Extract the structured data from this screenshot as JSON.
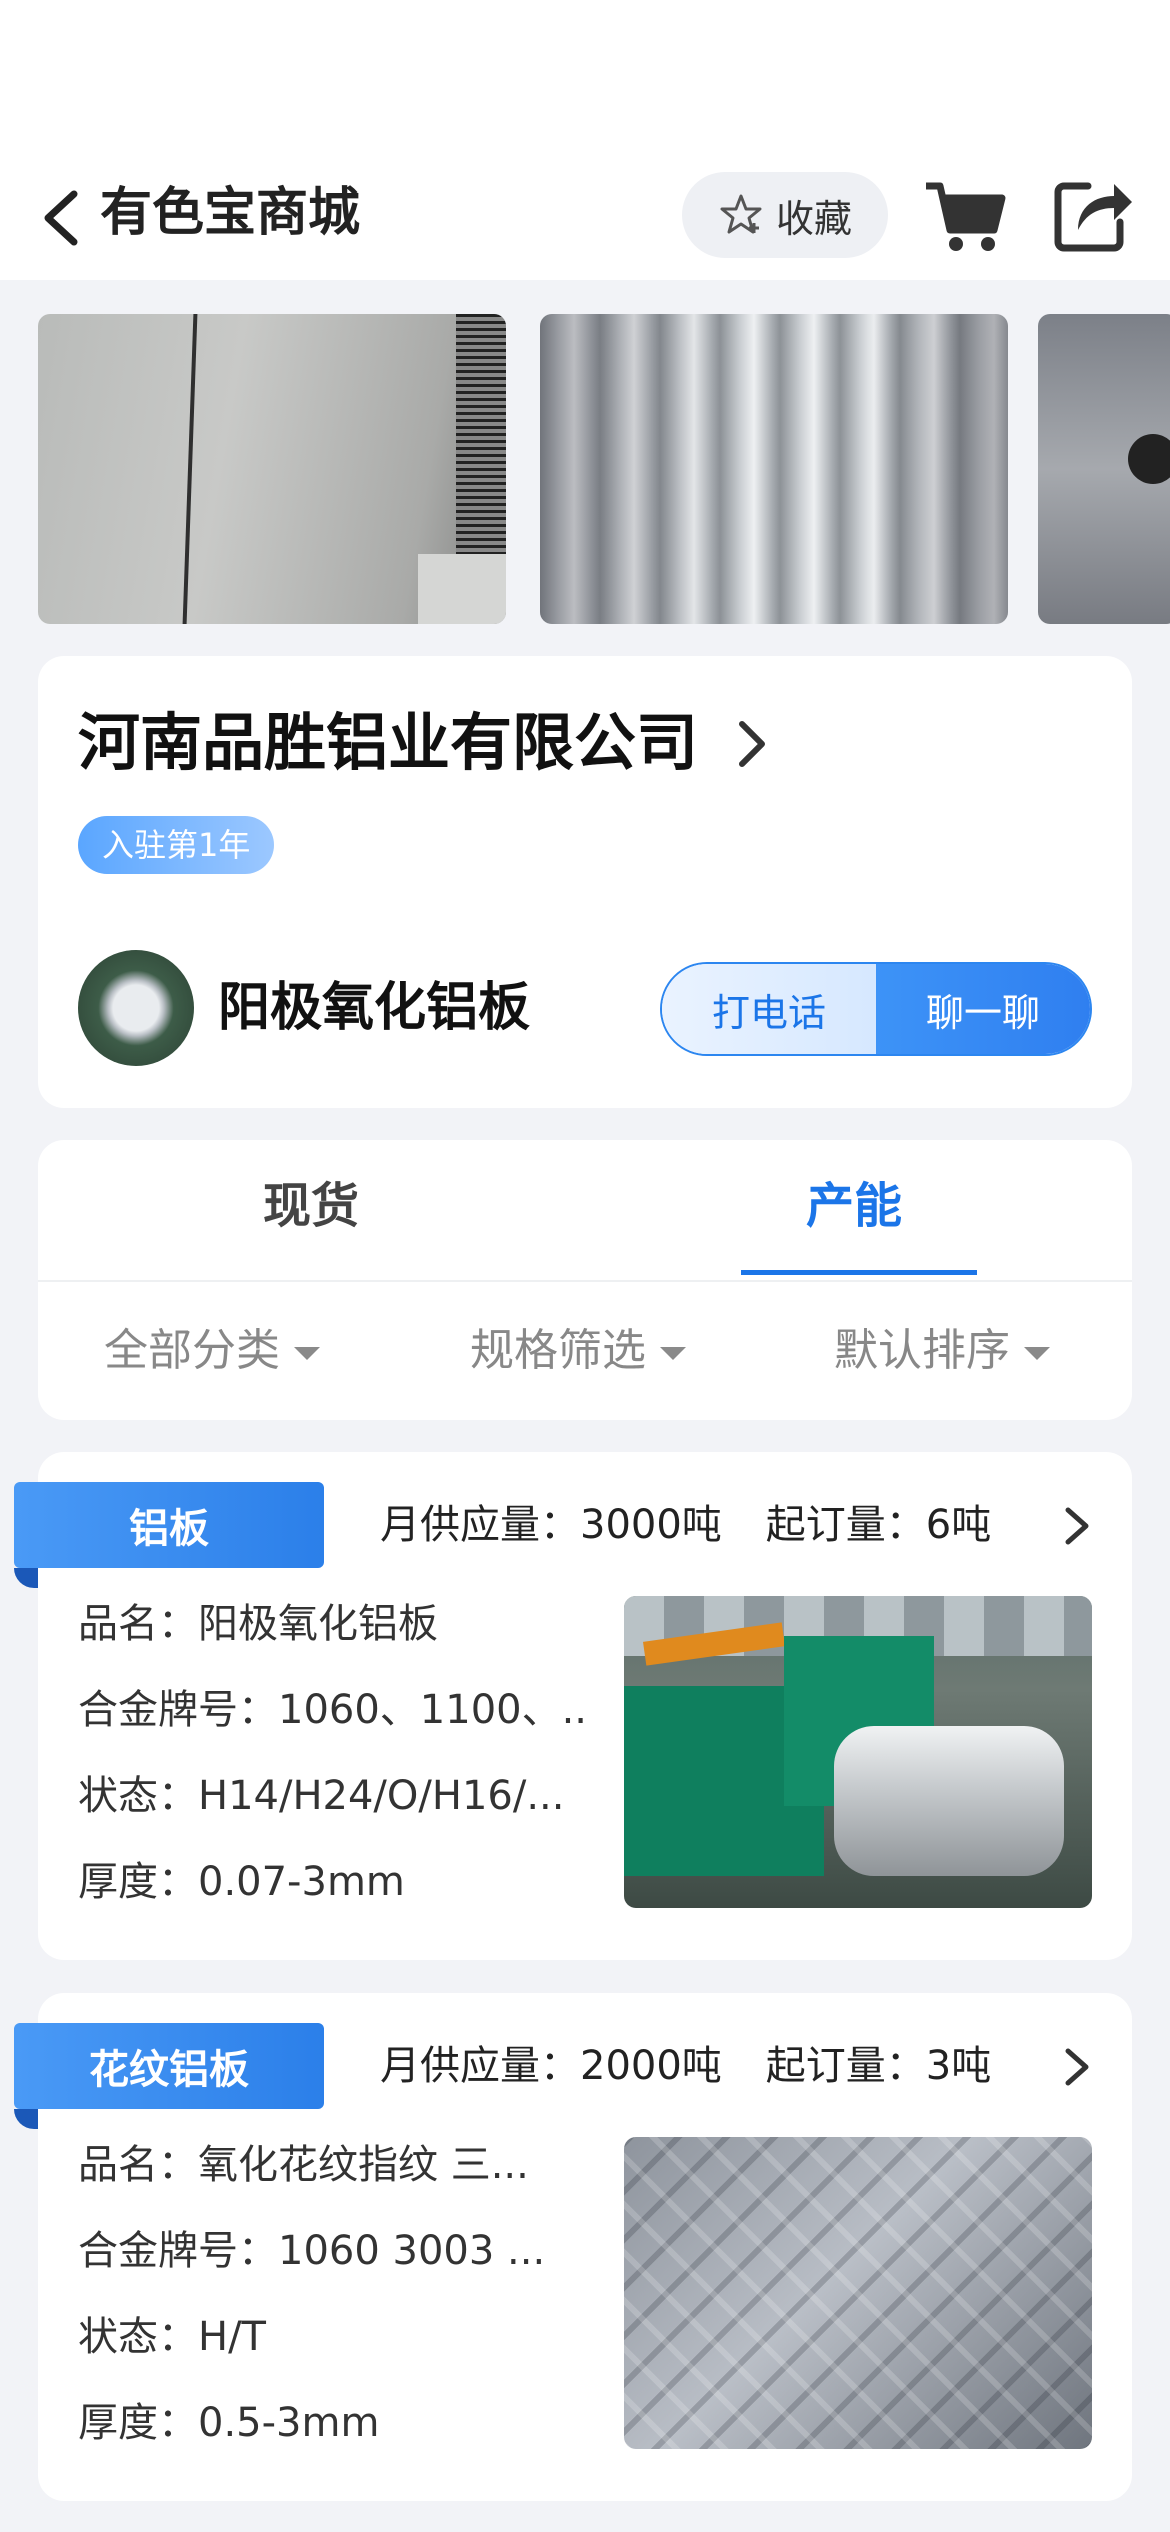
{
  "nav": {
    "title": "有色宝商城",
    "favorite_label": "收藏"
  },
  "company": {
    "name": "河南品胜铝业有限公司",
    "tenure_badge": "入驻第1年",
    "shop_name": "阳极氧化铝板",
    "call_label": "打电话",
    "chat_label": "聊一聊"
  },
  "tabs": [
    {
      "label": "现货",
      "active": false
    },
    {
      "label": "产能",
      "active": true
    }
  ],
  "filters": [
    {
      "label": "全部分类"
    },
    {
      "label": "规格筛选"
    },
    {
      "label": "默认排序"
    }
  ],
  "products": [
    {
      "category": "铝板",
      "monthly_supply": "月供应量：3000吨",
      "min_order": "起订量：6吨",
      "name_line": "品名：阳极氧化铝板",
      "alloy_line": "合金牌号：1060、1100、..",
      "state_line": "状态：H14/H24/O/H16/...",
      "thickness_line": "厚度：0.07-3mm"
    },
    {
      "category": "花纹铝板",
      "monthly_supply": "月供应量：2000吨",
      "min_order": "起订量：3吨",
      "name_line": "品名：氧化花纹指纹 三...",
      "alloy_line": "合金牌号：1060 3003 ...",
      "state_line": "状态：H/T",
      "thickness_line": "厚度：0.5-3mm"
    }
  ],
  "colors": {
    "accent": "#1b75e8",
    "page_bg": "#f2f3f7",
    "card_bg": "#ffffff"
  },
  "icons": [
    "back-chevron-icon",
    "star-icon",
    "cart-icon",
    "share-icon",
    "chevron-right-icon",
    "caret-down-icon"
  ]
}
